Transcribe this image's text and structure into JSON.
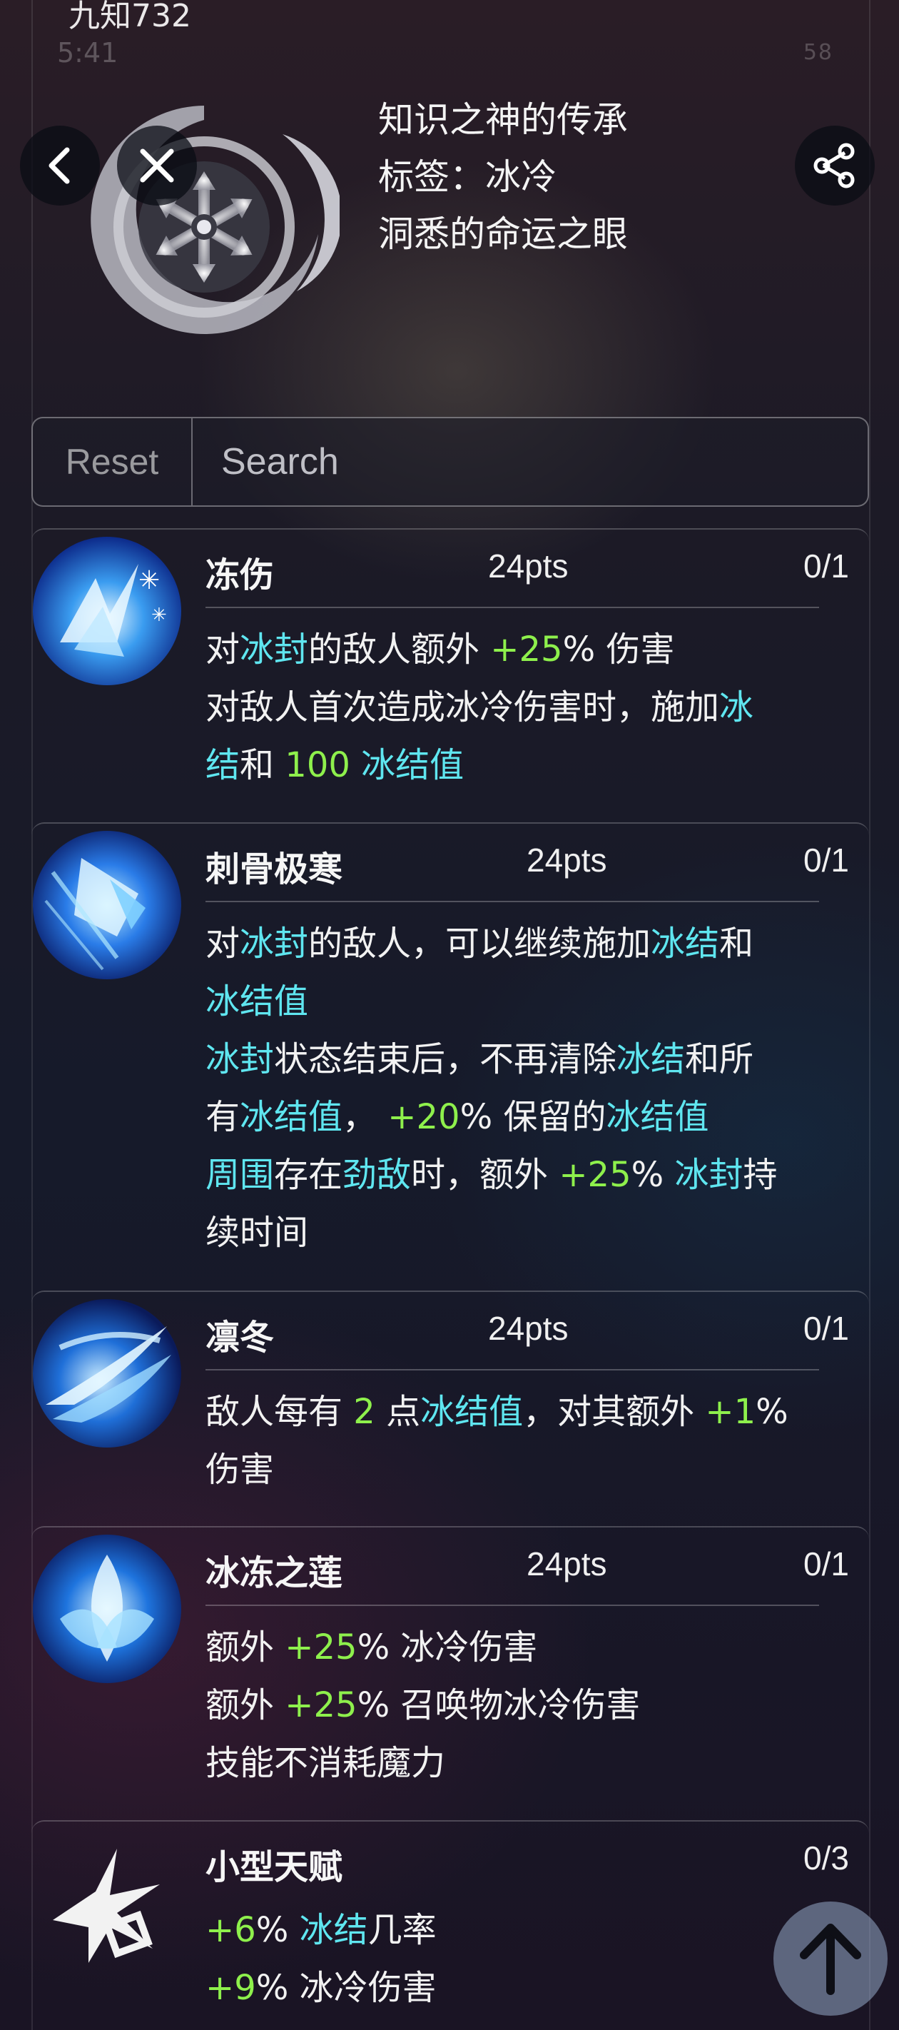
{
  "ghost": {
    "title": "九知732",
    "time": "5:41",
    "battery": "58"
  },
  "header": {
    "line1": "知识之神的传承",
    "line2": "标签：冰冷",
    "line3": "洞悉的命运之眼"
  },
  "search": {
    "reset_label": "Reset",
    "placeholder": "Search"
  },
  "talents": [
    {
      "name": "冻伤",
      "pts": "24pts",
      "level": "0/1"
    },
    {
      "name": "刺骨极寒",
      "pts": "24pts",
      "level": "0/1"
    },
    {
      "name": "凛冬",
      "pts": "24pts",
      "level": "0/1"
    },
    {
      "name": "冰冻之莲",
      "pts": "24pts",
      "level": "0/1"
    },
    {
      "name": "小型天赋",
      "pts": "",
      "level": "0/3"
    }
  ],
  "desc": {
    "t0": {
      "l1a": "对",
      "l1b": "冰封",
      "l1c": "的敌人额外 ",
      "l1d": "+25",
      "l1e": "% 伤害",
      "l2a": "对敌人首次造成冰冷伤害时，施加",
      "l2b": "冰",
      "l3a": "结",
      "l3b": "和 ",
      "l3c": "100",
      "l3d": " ",
      "l3e": "冰结值"
    },
    "t1": {
      "l1a": "对",
      "l1b": "冰封",
      "l1c": "的敌人，可以继续施加",
      "l1d": "冰结",
      "l1e": "和",
      "l2a": "冰结值",
      "l3a": "冰封",
      "l3b": "状态结束后，不再清除",
      "l3c": "冰结",
      "l3d": "和所",
      "l4a": "有",
      "l4b": "冰结值",
      "l4c": "，  ",
      "l4d": "+20",
      "l4e": "% 保留的",
      "l4f": "冰结值",
      "l5a": "周围",
      "l5b": "存在",
      "l5c": "劲敌",
      "l5d": "时，额外 ",
      "l5e": "+25",
      "l5f": "% ",
      "l5g": "冰封",
      "l5h": "持",
      "l6a": "续时间"
    },
    "t2": {
      "l1a": "敌人每有 ",
      "l1b": "2",
      "l1c": " 点",
      "l1d": "冰结值",
      "l1e": "，对其额外 ",
      "l1f": "+1",
      "l1g": "%",
      "l2a": "伤害"
    },
    "t3": {
      "l1a": "额外 ",
      "l1b": "+25",
      "l1c": "% 冰冷伤害",
      "l2a": "额外 ",
      "l2b": "+25",
      "l2c": "% 召唤物冰冷伤害",
      "l3a": "技能不消耗魔力"
    },
    "t4": {
      "l1a": "+6",
      "l1b": "% ",
      "l1c": "冰结",
      "l1d": "几率",
      "l2a": "+9",
      "l2b": "% 冰冷伤害"
    }
  },
  "colors": {
    "cyan": "#5fe6f0",
    "green": "#8ef04c"
  },
  "icons": [
    "chevron-left-icon",
    "close-icon",
    "share-icon",
    "arrow-up-icon",
    "snowflake-emblem-icon"
  ]
}
